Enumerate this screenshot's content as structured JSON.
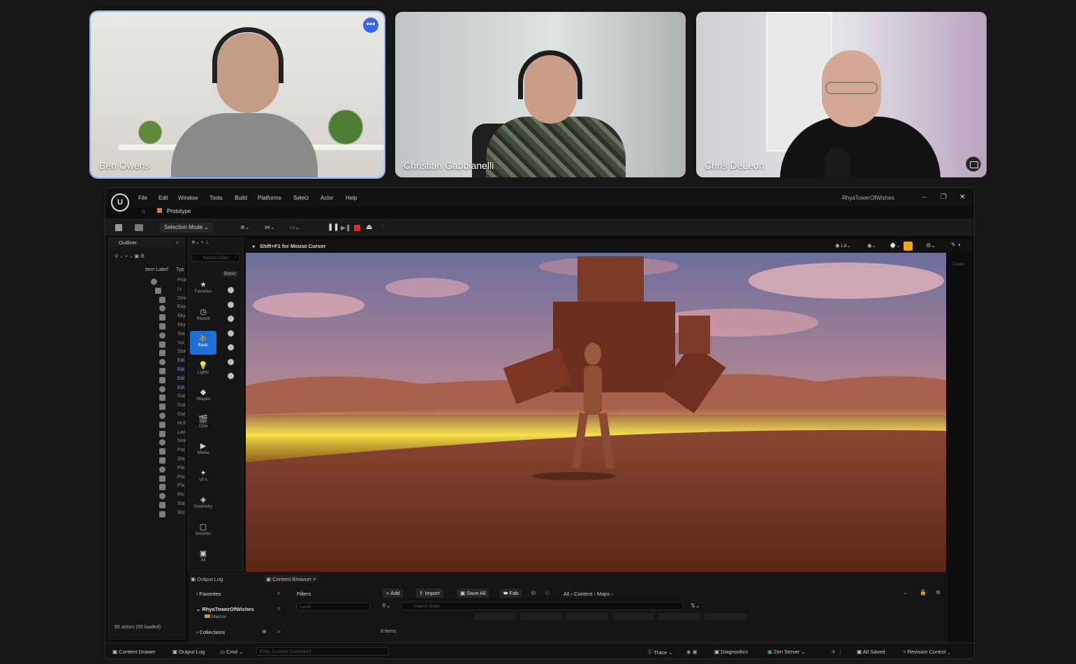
{
  "participants": [
    {
      "name": "Ben Owens",
      "more_label": "•••"
    },
    {
      "name": "Christian Gabbianelli"
    },
    {
      "name": "Chris DeLeon"
    }
  ],
  "editor": {
    "menu": [
      "File",
      "Edit",
      "Window",
      "Tools",
      "Build",
      "Platforms",
      "Select",
      "Actor",
      "Help"
    ],
    "project_name": "RhyaTowerOfWishes",
    "tab_label": "Prototype",
    "selection_mode": "Selection Mode",
    "outliner": {
      "title": "Outliner",
      "column_item": "Item Label",
      "column_type": "Typ",
      "rows": [
        "Prot",
        "Lt",
        "Dire",
        "Exp",
        "Sky",
        "Sky",
        "Sta",
        "Vol",
        "Slor",
        "Edi",
        "Edi",
        "Edi",
        "Edi",
        "Gar",
        "Gar",
        "Gar",
        "HUI",
        "Lan",
        "Nav",
        "Par",
        "Sta",
        "Pla",
        "Pla",
        "Pla",
        "Ric",
        "Sta",
        "Wo"
      ],
      "col2": [
        "Wo",
        "Fol"
      ],
      "actor_count": "65 actors (65 loaded)"
    },
    "place_actors": {
      "search_placeholder": "Search Clas",
      "basic_label": "Basic",
      "categories": [
        "Favorites",
        "Recent",
        "Basic",
        "Lights",
        "Shapes",
        "Cine",
        "Media",
        "VFX",
        "Geometry",
        "Volumes",
        "All"
      ]
    },
    "viewport": {
      "hint": "Shift+F1 for Mouse Cursor",
      "lit_label": "Lit",
      "right_label": "Detail"
    },
    "bottom": {
      "tabs": [
        "Output Log",
        "Content Browser"
      ],
      "favorites": "Favorites",
      "project_folder": "RhyaTowerOfWishes",
      "macros": "Macros",
      "collections": "Collections",
      "filters": "Filters",
      "level_placeholder": "Level",
      "add": "Add",
      "import": "Import",
      "save_all": "Save All",
      "fab": "Fab",
      "breadcrumb": [
        "All",
        "Content",
        "Maps"
      ],
      "search_placeholder": "Search Maps",
      "items_count": "8 items"
    },
    "status": {
      "content_drawer": "Content Drawer",
      "output_log": "Output Log",
      "cmd": "Cmd",
      "console_placeholder": "Enter Console Command",
      "trace": "Trace",
      "diagnostics": "Diagnostics",
      "zen_server": "Zen Server",
      "all_saved": "All Saved",
      "revision_control": "Revision Control"
    }
  },
  "colors": {
    "accent": "#1f6fd8",
    "active_border": "#9bb3ff",
    "stop_red": "#e02b2b",
    "lava_yellow": "#f4e04a"
  }
}
